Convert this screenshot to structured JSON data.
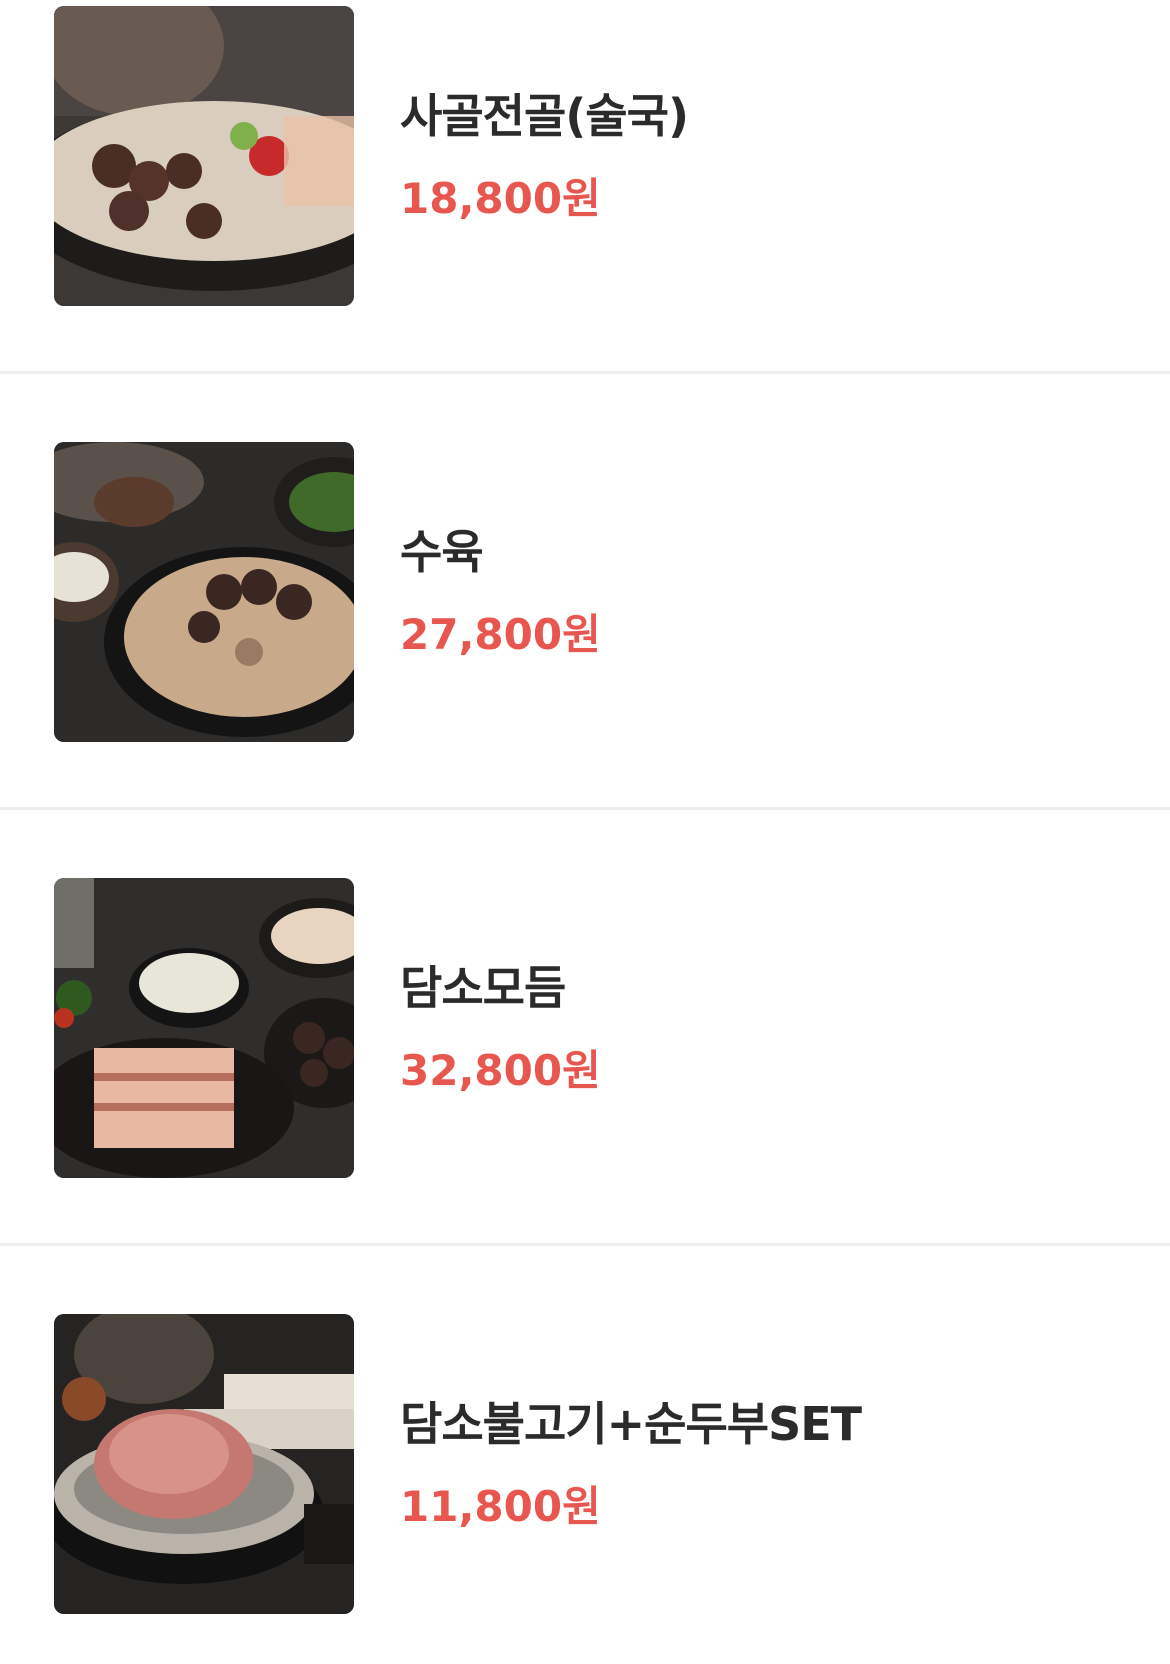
{
  "menu": {
    "items": [
      {
        "name": "사골전골(술국)",
        "price": "18,800원",
        "image": "beef-bone-hotpot-photo"
      },
      {
        "name": "수육",
        "price": "27,800원",
        "image": "boiled-pork-slices-photo"
      },
      {
        "name": "담소모듬",
        "price": "32,800원",
        "image": "assorted-platter-photo"
      },
      {
        "name": "담소불고기+순두부SET",
        "price": "11,800원",
        "image": "bulgogi-sundubu-set-photo"
      }
    ]
  },
  "colors": {
    "price": "#e8574f",
    "name": "#2b2b2b",
    "divider": "#eeeeee"
  }
}
